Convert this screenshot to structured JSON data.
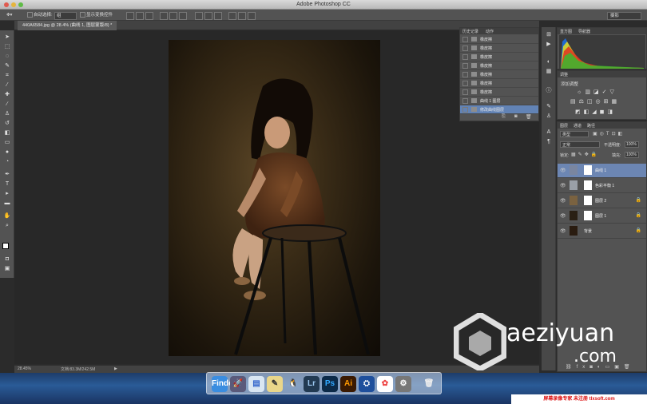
{
  "window": {
    "title": "Adobe Photoshop CC"
  },
  "options_bar": {
    "auto_select_label": "自动选择:",
    "auto_select_value": "组",
    "show_transform_label": "显示变换控件",
    "workspace": "摄影"
  },
  "document": {
    "tab_label": "440A6584.jpg @ 28.4% (曲线 1, 图层蒙版/8) *",
    "zoom": "28.45%",
    "doc_size": "文档:83.3M/242.5M"
  },
  "history_panel": {
    "tabs": [
      "历史记录",
      "动作"
    ],
    "items": [
      {
        "label": "橡皮擦",
        "selected": false
      },
      {
        "label": "橡皮擦",
        "selected": false
      },
      {
        "label": "橡皮擦",
        "selected": false
      },
      {
        "label": "橡皮擦",
        "selected": false
      },
      {
        "label": "橡皮擦",
        "selected": false
      },
      {
        "label": "橡皮擦",
        "selected": false
      },
      {
        "label": "橡皮擦",
        "selected": false
      },
      {
        "label": "曲线 1 图层",
        "selected": false
      },
      {
        "label": "修改曲线图层",
        "selected": true
      }
    ]
  },
  "histogram_panel": {
    "tabs": [
      "直方图",
      "导航器"
    ]
  },
  "adjustments_panel": {
    "tabs": [
      "调整"
    ],
    "title": "添加调整"
  },
  "layers_panel": {
    "tabs": [
      "图层",
      "通道",
      "路径"
    ],
    "filter_kind": "类型",
    "blend_mode": "正常",
    "opacity_label": "不透明度:",
    "opacity_value": "100%",
    "lock_label": "锁定:",
    "fill_label": "填充:",
    "fill_value": "100%",
    "layers": [
      {
        "name": "曲线 1",
        "selected": true,
        "locked": false
      },
      {
        "name": "色彩平衡 1",
        "selected": false,
        "locked": false
      },
      {
        "name": "图层 2",
        "selected": false,
        "locked": true
      },
      {
        "name": "图层 1",
        "selected": false,
        "locked": true
      },
      {
        "name": "背景",
        "selected": false,
        "locked": true
      }
    ]
  },
  "dock": {
    "apps": [
      "Finder",
      "Launchpad",
      "Preview",
      "Script",
      "QQ",
      "Lr",
      "Ps",
      "Ai",
      "Disk",
      "Photos",
      "System",
      "Trash"
    ]
  },
  "watermark": {
    "line1": "aeziyuan",
    "line2": ".com"
  },
  "banner": {
    "text": "屏幕录像专家 未注册 tlxsoft.com"
  },
  "colors": {
    "selection": "#6283b5",
    "panel_bg": "#535353",
    "canvas_bg": "#282828"
  }
}
